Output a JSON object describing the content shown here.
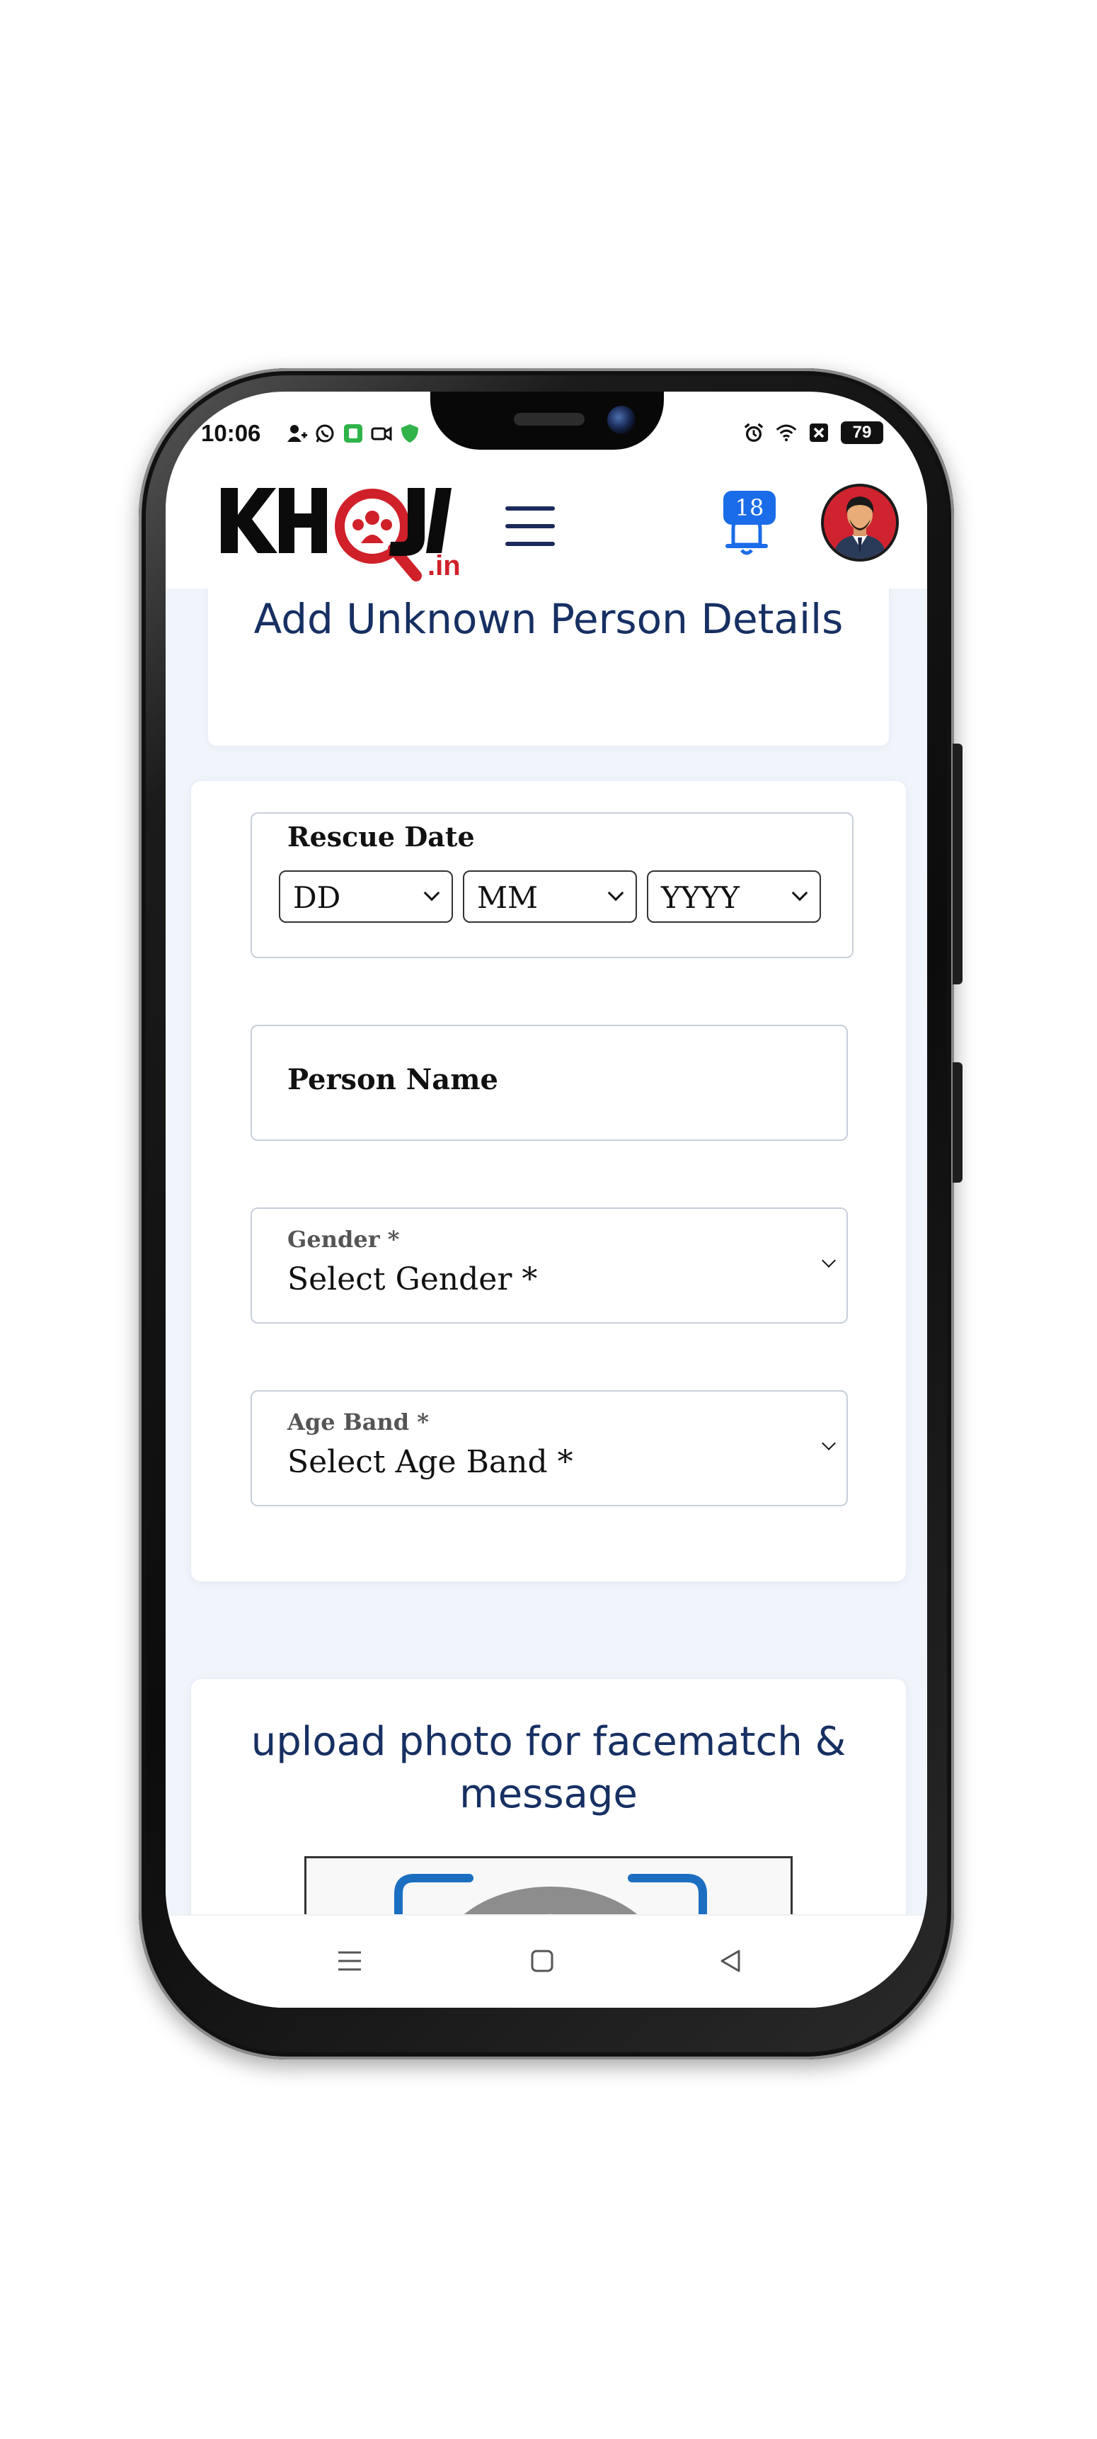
{
  "status_bar": {
    "time": "10:06",
    "battery": "79",
    "left_icons": [
      "person-add-icon",
      "whatsapp-icon",
      "app-notification-icon",
      "video-icon",
      "shield-icon"
    ],
    "right_icons": [
      "alarm-icon",
      "wifi-icon",
      "no-sim-icon",
      "battery-icon"
    ]
  },
  "header": {
    "logo_text": "KHOJI",
    "logo_domain": ".in",
    "notification_count": "18",
    "icons": [
      "hamburger-menu-icon",
      "bell-icon",
      "avatar"
    ]
  },
  "page": {
    "title": "Add Unknown Person Details"
  },
  "form": {
    "rescue_date": {
      "legend": "Rescue Date",
      "day": "DD",
      "month": "MM",
      "year": "YYYY"
    },
    "person_name": {
      "label": "Person Name"
    },
    "gender": {
      "label": "Gender *",
      "value": "Select Gender *"
    },
    "age_band": {
      "label": "Age Band *",
      "value": "Select Age Band *"
    }
  },
  "upload": {
    "title": "upload photo for facematch & message"
  },
  "nav": {
    "icons": [
      "menu-icon",
      "home-icon",
      "back-icon"
    ]
  },
  "colors": {
    "primary_text": "#173063",
    "brand_red": "#d0202a",
    "badge_blue": "#1a6ce8",
    "page_background": "#f0f4fb"
  }
}
